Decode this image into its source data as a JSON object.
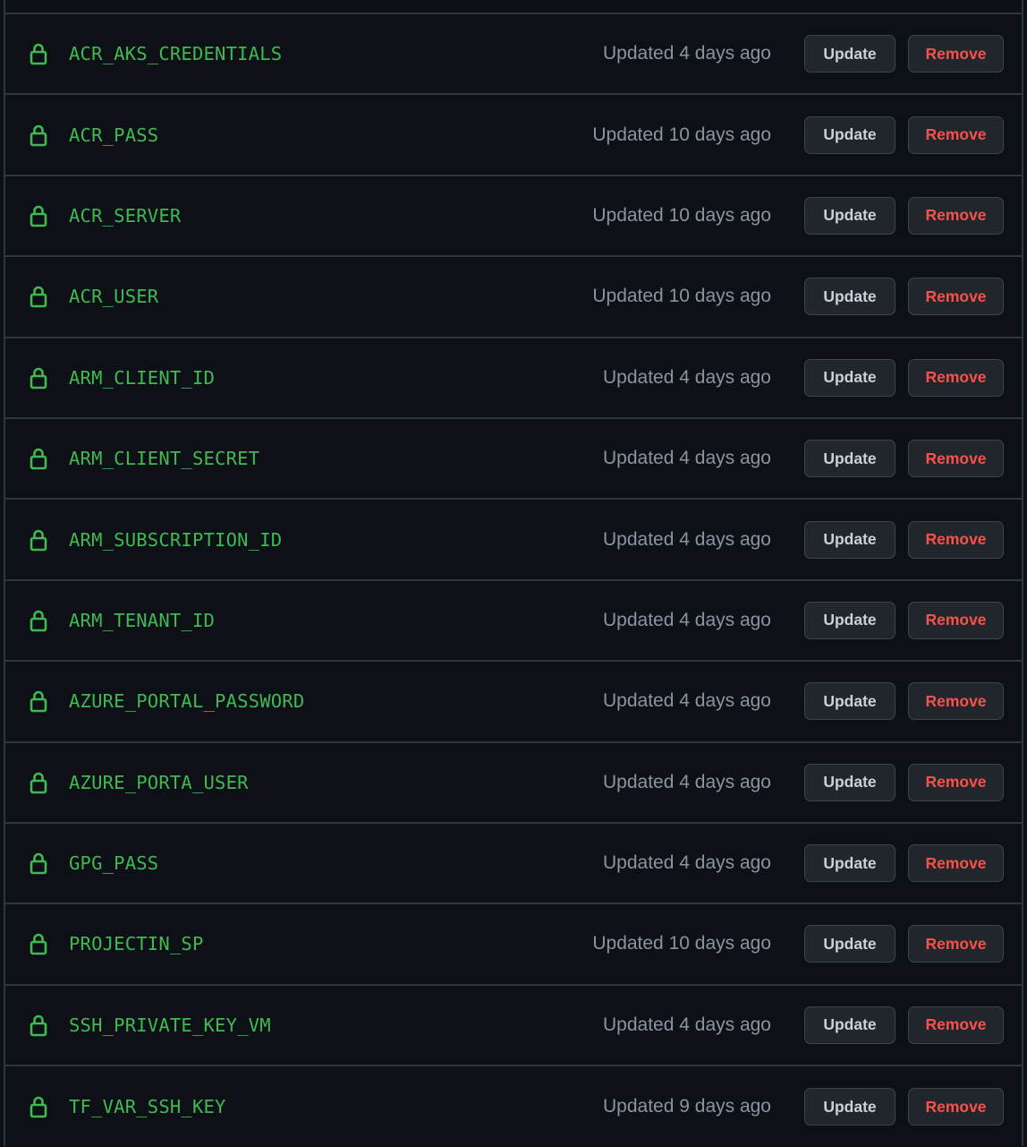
{
  "colors": {
    "background": "#0d1117",
    "border": "#30363d",
    "secret_name": "#3fb950",
    "lock_icon": "#3fb950",
    "muted_text": "#8b949e",
    "button_bg": "#21262d",
    "update_text": "#c9d1d9",
    "remove_text": "#f85149"
  },
  "icons": {
    "row_icon": "lock-icon"
  },
  "secrets": [
    {
      "name": "ACR_AKS_CREDENTIALS",
      "updated": "Updated 4 days ago",
      "update_label": "Update",
      "remove_label": "Remove"
    },
    {
      "name": "ACR_PASS",
      "updated": "Updated 10 days ago",
      "update_label": "Update",
      "remove_label": "Remove"
    },
    {
      "name": "ACR_SERVER",
      "updated": "Updated 10 days ago",
      "update_label": "Update",
      "remove_label": "Remove"
    },
    {
      "name": "ACR_USER",
      "updated": "Updated 10 days ago",
      "update_label": "Update",
      "remove_label": "Remove"
    },
    {
      "name": "ARM_CLIENT_ID",
      "updated": "Updated 4 days ago",
      "update_label": "Update",
      "remove_label": "Remove"
    },
    {
      "name": "ARM_CLIENT_SECRET",
      "updated": "Updated 4 days ago",
      "update_label": "Update",
      "remove_label": "Remove"
    },
    {
      "name": "ARM_SUBSCRIPTION_ID",
      "updated": "Updated 4 days ago",
      "update_label": "Update",
      "remove_label": "Remove"
    },
    {
      "name": "ARM_TENANT_ID",
      "updated": "Updated 4 days ago",
      "update_label": "Update",
      "remove_label": "Remove"
    },
    {
      "name": "AZURE_PORTAL_PASSWORD",
      "updated": "Updated 4 days ago",
      "update_label": "Update",
      "remove_label": "Remove"
    },
    {
      "name": "AZURE_PORTA_USER",
      "updated": "Updated 4 days ago",
      "update_label": "Update",
      "remove_label": "Remove"
    },
    {
      "name": "GPG_PASS",
      "updated": "Updated 4 days ago",
      "update_label": "Update",
      "remove_label": "Remove"
    },
    {
      "name": "PROJECTIN_SP",
      "updated": "Updated 10 days ago",
      "update_label": "Update",
      "remove_label": "Remove"
    },
    {
      "name": "SSH_PRIVATE_KEY_VM",
      "updated": "Updated 4 days ago",
      "update_label": "Update",
      "remove_label": "Remove"
    },
    {
      "name": "TF_VAR_SSH_KEY",
      "updated": "Updated 9 days ago",
      "update_label": "Update",
      "remove_label": "Remove"
    }
  ]
}
